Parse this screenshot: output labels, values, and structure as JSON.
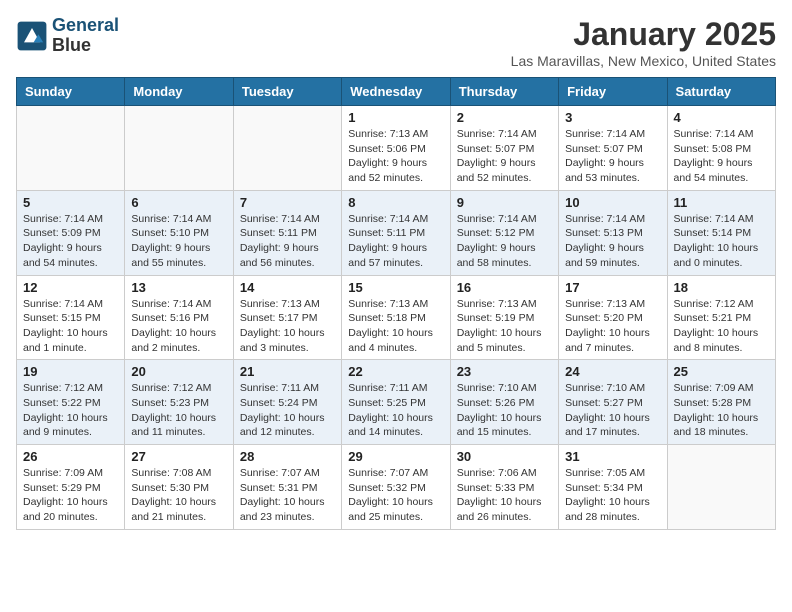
{
  "header": {
    "logo_line1": "General",
    "logo_line2": "Blue",
    "title": "January 2025",
    "subtitle": "Las Maravillas, New Mexico, United States"
  },
  "weekdays": [
    "Sunday",
    "Monday",
    "Tuesday",
    "Wednesday",
    "Thursday",
    "Friday",
    "Saturday"
  ],
  "weeks": [
    [
      {
        "day": "",
        "info": ""
      },
      {
        "day": "",
        "info": ""
      },
      {
        "day": "",
        "info": ""
      },
      {
        "day": "1",
        "info": "Sunrise: 7:13 AM\nSunset: 5:06 PM\nDaylight: 9 hours and 52 minutes."
      },
      {
        "day": "2",
        "info": "Sunrise: 7:14 AM\nSunset: 5:07 PM\nDaylight: 9 hours and 52 minutes."
      },
      {
        "day": "3",
        "info": "Sunrise: 7:14 AM\nSunset: 5:07 PM\nDaylight: 9 hours and 53 minutes."
      },
      {
        "day": "4",
        "info": "Sunrise: 7:14 AM\nSunset: 5:08 PM\nDaylight: 9 hours and 54 minutes."
      }
    ],
    [
      {
        "day": "5",
        "info": "Sunrise: 7:14 AM\nSunset: 5:09 PM\nDaylight: 9 hours and 54 minutes."
      },
      {
        "day": "6",
        "info": "Sunrise: 7:14 AM\nSunset: 5:10 PM\nDaylight: 9 hours and 55 minutes."
      },
      {
        "day": "7",
        "info": "Sunrise: 7:14 AM\nSunset: 5:11 PM\nDaylight: 9 hours and 56 minutes."
      },
      {
        "day": "8",
        "info": "Sunrise: 7:14 AM\nSunset: 5:11 PM\nDaylight: 9 hours and 57 minutes."
      },
      {
        "day": "9",
        "info": "Sunrise: 7:14 AM\nSunset: 5:12 PM\nDaylight: 9 hours and 58 minutes."
      },
      {
        "day": "10",
        "info": "Sunrise: 7:14 AM\nSunset: 5:13 PM\nDaylight: 9 hours and 59 minutes."
      },
      {
        "day": "11",
        "info": "Sunrise: 7:14 AM\nSunset: 5:14 PM\nDaylight: 10 hours and 0 minutes."
      }
    ],
    [
      {
        "day": "12",
        "info": "Sunrise: 7:14 AM\nSunset: 5:15 PM\nDaylight: 10 hours and 1 minute."
      },
      {
        "day": "13",
        "info": "Sunrise: 7:14 AM\nSunset: 5:16 PM\nDaylight: 10 hours and 2 minutes."
      },
      {
        "day": "14",
        "info": "Sunrise: 7:13 AM\nSunset: 5:17 PM\nDaylight: 10 hours and 3 minutes."
      },
      {
        "day": "15",
        "info": "Sunrise: 7:13 AM\nSunset: 5:18 PM\nDaylight: 10 hours and 4 minutes."
      },
      {
        "day": "16",
        "info": "Sunrise: 7:13 AM\nSunset: 5:19 PM\nDaylight: 10 hours and 5 minutes."
      },
      {
        "day": "17",
        "info": "Sunrise: 7:13 AM\nSunset: 5:20 PM\nDaylight: 10 hours and 7 minutes."
      },
      {
        "day": "18",
        "info": "Sunrise: 7:12 AM\nSunset: 5:21 PM\nDaylight: 10 hours and 8 minutes."
      }
    ],
    [
      {
        "day": "19",
        "info": "Sunrise: 7:12 AM\nSunset: 5:22 PM\nDaylight: 10 hours and 9 minutes."
      },
      {
        "day": "20",
        "info": "Sunrise: 7:12 AM\nSunset: 5:23 PM\nDaylight: 10 hours and 11 minutes."
      },
      {
        "day": "21",
        "info": "Sunrise: 7:11 AM\nSunset: 5:24 PM\nDaylight: 10 hours and 12 minutes."
      },
      {
        "day": "22",
        "info": "Sunrise: 7:11 AM\nSunset: 5:25 PM\nDaylight: 10 hours and 14 minutes."
      },
      {
        "day": "23",
        "info": "Sunrise: 7:10 AM\nSunset: 5:26 PM\nDaylight: 10 hours and 15 minutes."
      },
      {
        "day": "24",
        "info": "Sunrise: 7:10 AM\nSunset: 5:27 PM\nDaylight: 10 hours and 17 minutes."
      },
      {
        "day": "25",
        "info": "Sunrise: 7:09 AM\nSunset: 5:28 PM\nDaylight: 10 hours and 18 minutes."
      }
    ],
    [
      {
        "day": "26",
        "info": "Sunrise: 7:09 AM\nSunset: 5:29 PM\nDaylight: 10 hours and 20 minutes."
      },
      {
        "day": "27",
        "info": "Sunrise: 7:08 AM\nSunset: 5:30 PM\nDaylight: 10 hours and 21 minutes."
      },
      {
        "day": "28",
        "info": "Sunrise: 7:07 AM\nSunset: 5:31 PM\nDaylight: 10 hours and 23 minutes."
      },
      {
        "day": "29",
        "info": "Sunrise: 7:07 AM\nSunset: 5:32 PM\nDaylight: 10 hours and 25 minutes."
      },
      {
        "day": "30",
        "info": "Sunrise: 7:06 AM\nSunset: 5:33 PM\nDaylight: 10 hours and 26 minutes."
      },
      {
        "day": "31",
        "info": "Sunrise: 7:05 AM\nSunset: 5:34 PM\nDaylight: 10 hours and 28 minutes."
      },
      {
        "day": "",
        "info": ""
      }
    ]
  ]
}
